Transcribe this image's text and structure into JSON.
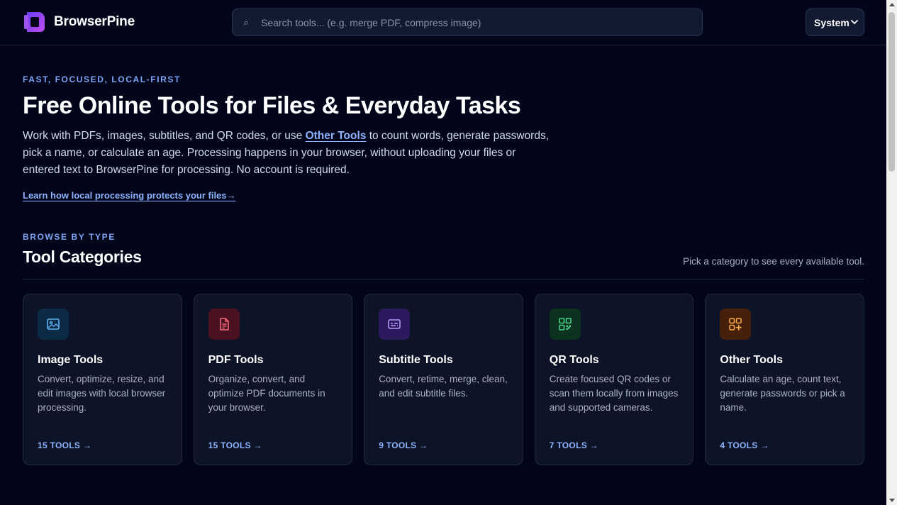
{
  "brand": {
    "name": "BrowserPine"
  },
  "search": {
    "placeholder": "Search tools... (e.g. merge PDF, compress image)"
  },
  "theme": {
    "selected": "System"
  },
  "hero": {
    "eyebrow": "FAST, FOCUSED, LOCAL-FIRST",
    "title": "Free Online Tools for Files & Everyday Tasks",
    "desc_before": "Work with PDFs, images, subtitles, and QR codes, or use ",
    "desc_link": "Other Tools",
    "desc_after": " to count words, generate passwords, pick a name, or calculate an age. Processing happens in your browser, without uploading your files or entered text to BrowserPine for processing. No account is required.",
    "learn_link": "Learn how local processing protects your files→"
  },
  "categories": {
    "eyebrow": "BROWSE BY TYPE",
    "title": "Tool Categories",
    "hint": "Pick a category to see every available tool.",
    "items": [
      {
        "title": "Image Tools",
        "desc": "Convert, optimize, resize, and edit images with local browser processing.",
        "count": "15 TOOLS →",
        "icon": "image-icon",
        "icon_bg": "#0b2a45",
        "icon_color": "#5eb3f5"
      },
      {
        "title": "PDF Tools",
        "desc": "Organize, convert, and optimize PDF documents in your browser.",
        "count": "15 TOOLS →",
        "icon": "document-icon",
        "icon_bg": "#4a1220",
        "icon_color": "#f06b7a"
      },
      {
        "title": "Subtitle Tools",
        "desc": "Convert, retime, merge, clean, and edit subtitle files.",
        "count": "9 TOOLS →",
        "icon": "subtitles-icon",
        "icon_bg": "#2d1a5e",
        "icon_color": "#b596f5"
      },
      {
        "title": "QR Tools",
        "desc": "Create focused QR codes or scan them locally from images and supported cameras.",
        "count": "7 TOOLS →",
        "icon": "qr-code-icon",
        "icon_bg": "#0b3320",
        "icon_color": "#4cd08a"
      },
      {
        "title": "Other Tools",
        "desc": "Calculate an age, count text, generate passwords or pick a name.",
        "count": "4 TOOLS →",
        "icon": "apps-plus-icon",
        "icon_bg": "#46200b",
        "icon_color": "#f5a74a"
      }
    ]
  },
  "colors": {
    "background": "#03061a",
    "accent": "#8db4ff",
    "brand_purple": "#7c4dff"
  }
}
